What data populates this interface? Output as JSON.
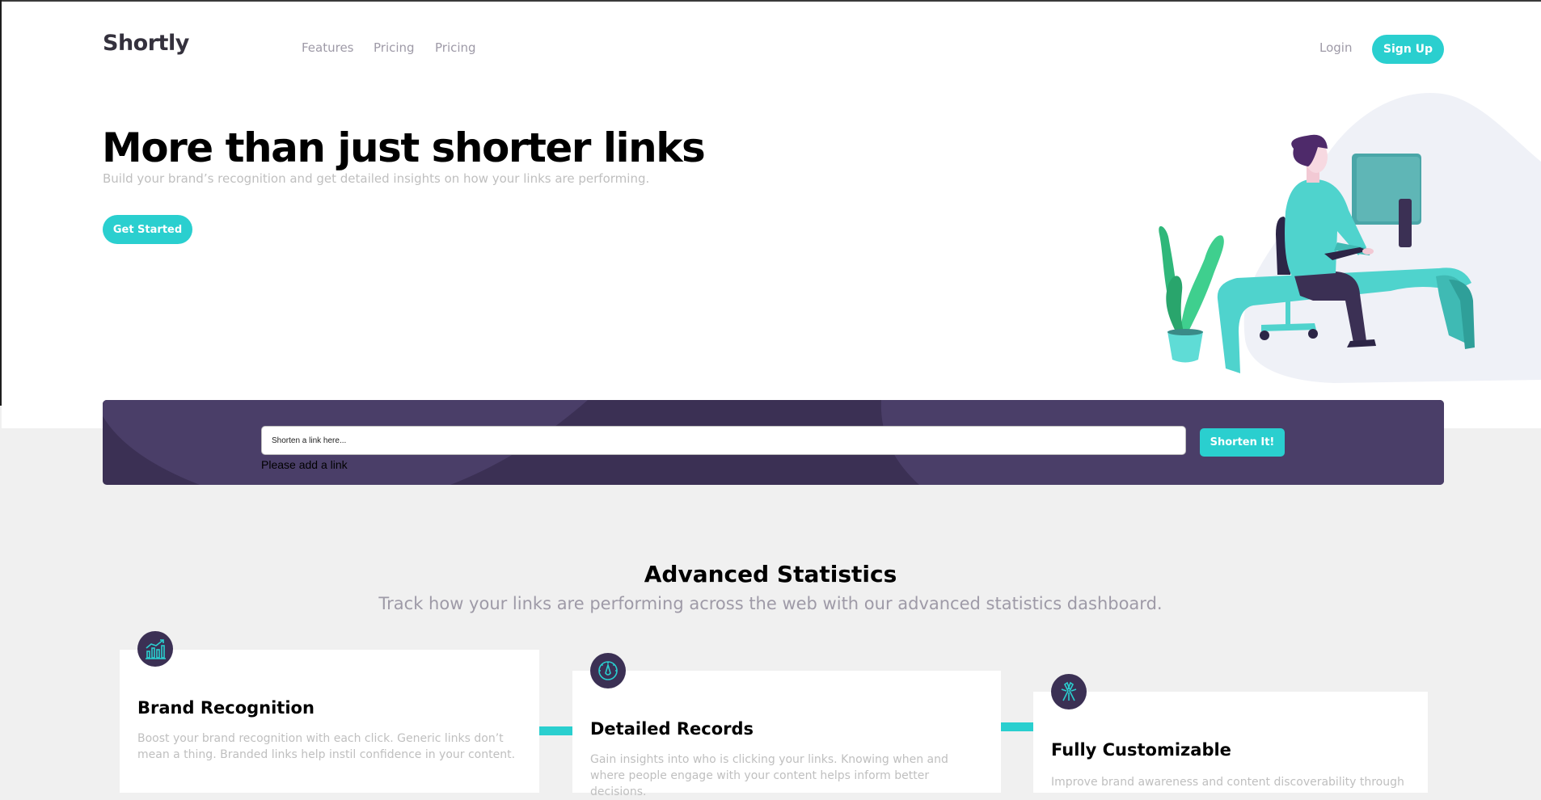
{
  "header": {
    "logo": "Shortly",
    "nav": [
      "Features",
      "Pricing",
      "Pricing"
    ],
    "login": "Login",
    "signup": "Sign Up"
  },
  "hero": {
    "title": "More than just shorter links",
    "subtitle": "Build your brand’s recognition and get detailed insights on how your links are performing.",
    "cta": "Get Started",
    "illustration": "person-working-at-desk-illustration"
  },
  "shorten": {
    "placeholder": "Shorten a link here...",
    "button": "Shorten It!",
    "error": "Please add a link"
  },
  "stats": {
    "title": "Advanced Statistics",
    "subtitle": "Track how your links are performing across the web with our advanced statistics dashboard.",
    "cards": [
      {
        "icon": "brand-recognition-icon",
        "title": "Brand Recognition",
        "text": "Boost your brand recognition with each click. Generic links don’t mean a thing. Branded links help instil confidence in your content."
      },
      {
        "icon": "detailed-records-icon",
        "title": "Detailed Records",
        "text": "Gain insights into who is clicking your links. Knowing when and where people engage with your content helps inform better decisions."
      },
      {
        "icon": "fully-customizable-icon",
        "title": "Fully Customizable",
        "text": "Improve brand awareness and content discoverability through"
      }
    ]
  },
  "colors": {
    "cyan": "#2acfcf",
    "dark_violet": "#3b3054",
    "grayish_violet": "#9e9aa7",
    "very_dark_blue": "#34313d",
    "light_gray": "#f0f0f0"
  }
}
